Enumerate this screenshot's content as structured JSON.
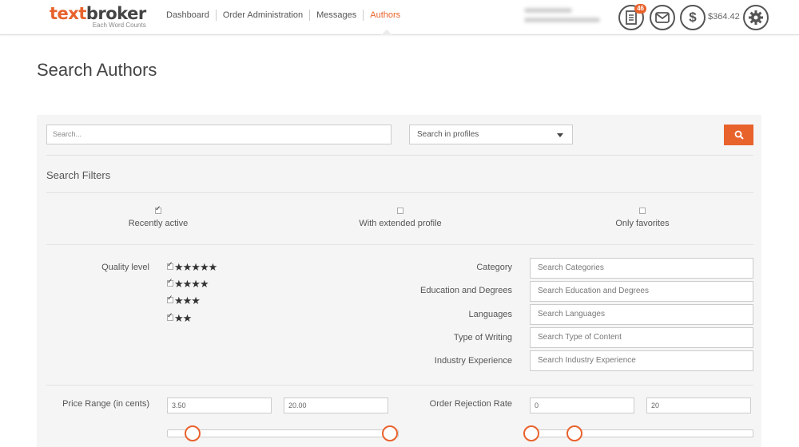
{
  "header": {
    "logo_part1": "text",
    "logo_part2": "broker",
    "logo_tagline": "Each Word Counts",
    "nav": [
      "Dashboard",
      "Order Administration",
      "Messages",
      "Authors"
    ],
    "active_nav": "Authors",
    "orders_badge": "46",
    "balance": "$364.42",
    "icons": [
      "document-icon",
      "mail-icon",
      "dollar-icon",
      "gear-icon"
    ],
    "accent_color": "#e8622c"
  },
  "page_title": "Search Authors",
  "search": {
    "placeholder": "Search...",
    "scope_selected": "Search in profiles"
  },
  "filters": {
    "title": "Search Filters",
    "options": [
      {
        "label": "Recently active",
        "checked": true
      },
      {
        "label": "With extended profile",
        "checked": false
      },
      {
        "label": "Only favorites",
        "checked": false
      }
    ],
    "quality_label": "Quality level",
    "quality_levels": [
      {
        "stars": "★★★★★",
        "checked": true
      },
      {
        "stars": "★★★★",
        "checked": true
      },
      {
        "stars": "★★★",
        "checked": true
      },
      {
        "stars": "★★",
        "checked": true
      }
    ],
    "category_fields": [
      {
        "label": "Category",
        "placeholder": "Search Categories"
      },
      {
        "label": "Education and Degrees",
        "placeholder": "Search Education and Degrees"
      },
      {
        "label": "Languages",
        "placeholder": "Search Languages"
      },
      {
        "label": "Type of Writing",
        "placeholder": "Search Type of Content"
      },
      {
        "label": "Industry Experience",
        "placeholder": "Search Industry Experience"
      }
    ],
    "price_range": {
      "label": "Price Range (in cents)",
      "min": "3.50",
      "max": "20.00"
    },
    "rejection_rate": {
      "label": "Order Rejection Rate",
      "min": "0",
      "max": "20"
    }
  }
}
